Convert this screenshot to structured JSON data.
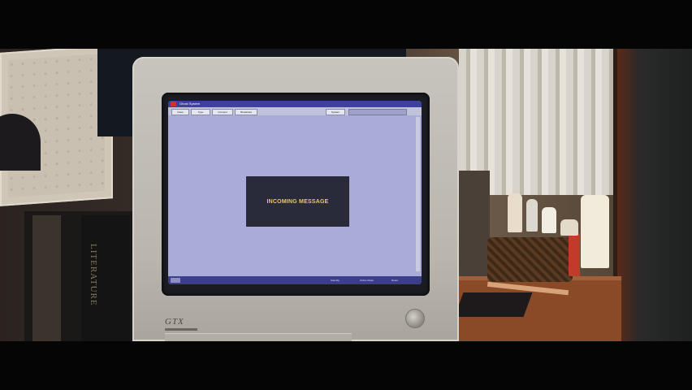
{
  "screen": {
    "window_title": "Ghost System",
    "toolbar_buttons": [
      "Draw",
      "Type",
      "Connect",
      "Broadcast",
      "System"
    ],
    "status_items": [
      "Standby",
      "Online Mode",
      "Reset"
    ],
    "alert_message": "INCOMING MESSAGE"
  },
  "monitor": {
    "brand": "GTX"
  },
  "book": {
    "spine_text": "LITERATURE"
  },
  "colors": {
    "screen_background": "#a9acd8",
    "titlebar": "#3f3f9c",
    "alert_box": "#292b3a",
    "alert_text": "#e8c96a"
  }
}
